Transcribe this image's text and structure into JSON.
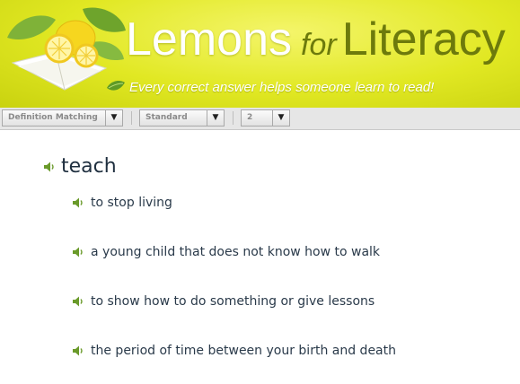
{
  "header": {
    "title_word1": "Lemons",
    "title_word2": "for",
    "title_word3": "Literacy",
    "tagline": "Every correct answer helps someone learn to read!"
  },
  "toolbar": {
    "mode_select": "Definition Matching",
    "difficulty_select": "Standard",
    "level_select": "2"
  },
  "question": {
    "word": "teach",
    "options": [
      "to stop living",
      "a young child that does not know how to walk",
      "to show how to do something or give lessons",
      "the period of time between your birth and death"
    ]
  },
  "colors": {
    "banner_yellow": "#e1e823",
    "title_olive": "#6d7a0c",
    "speaker_green": "#6a9a2a",
    "text_dark": "#2a3a4a"
  },
  "icons": {
    "logo": "lemons-book-logo",
    "tagline_leaf": "leaf-icon",
    "audio": "speaker-icon",
    "dropdown": "chevron-down-icon"
  }
}
